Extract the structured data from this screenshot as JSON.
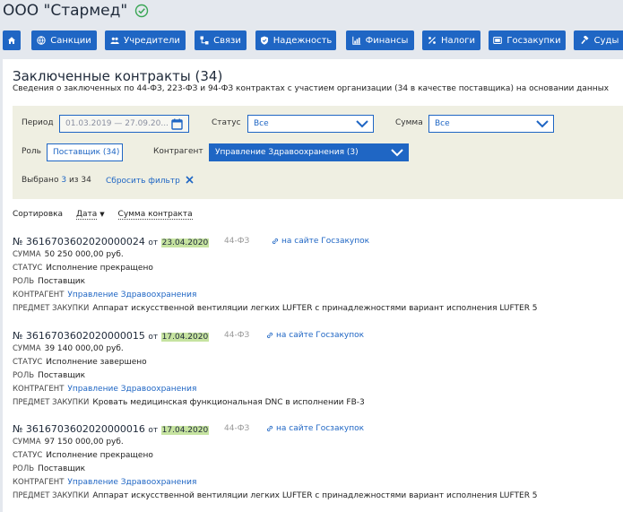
{
  "company": {
    "name": "ООО \"Стармед\"",
    "status_icon": "check-circle-icon"
  },
  "nav": {
    "items": [
      {
        "label": "",
        "icon": "home-icon"
      },
      {
        "label": "Санкции",
        "icon": "globe-icon"
      },
      {
        "label": "Учредители",
        "icon": "users-icon"
      },
      {
        "label": "Связи",
        "icon": "network-icon"
      },
      {
        "label": "Надежность",
        "icon": "shield-icon"
      },
      {
        "label": "Финансы",
        "icon": "chart-icon"
      },
      {
        "label": "Налоги",
        "icon": "percent-icon"
      },
      {
        "label": "Госзакупки",
        "icon": "card-icon"
      },
      {
        "label": "Суды",
        "icon": "gavel-icon"
      }
    ],
    "color": "#1f66c4"
  },
  "section": {
    "title": "Заключенные контракты (34)",
    "subtitle": "Сведения о заключенных по 44-ФЗ, 223-ФЗ и 94-ФЗ контрактах с участием организации (34 в качестве поставщика) на основании данных"
  },
  "filters": {
    "period_label": "Период",
    "period_value": "01.03.2019 — 27.09.20...",
    "status_label": "Статус",
    "status_value": "Все",
    "sum_label": "Сумма",
    "sum_value": "Все",
    "role_label": "Роль",
    "role_value": "Поставщик (34)",
    "counterparty_label": "Контрагент",
    "counterparty_value": "Управление Здравоохранения (3)",
    "selected_prefix": "Выбрано",
    "selected_count": "3",
    "selected_suffix": "из 34",
    "reset_label": "Сбросить фильтр"
  },
  "sort": {
    "label": "Сортировка",
    "date": "Дата",
    "sum": "Сумма контракта"
  },
  "contracts": [
    {
      "number": "№ 3616703602020000024",
      "from": "от",
      "date": "23.04.2020",
      "law": "44-ФЗ",
      "link": "на сайте Госзакупок",
      "sum_key": "СУММА",
      "sum": "50 250 000,00 руб.",
      "status_key": "СТАТУС",
      "status": "Исполнение прекращено",
      "role_key": "РОЛЬ",
      "role": "Поставщик",
      "party_key": "КОНТРАГЕНТ",
      "party": "Управление Здравоохранения",
      "subject_key": "ПРЕДМЕТ ЗАКУПКИ",
      "subject": "Аппарат искусственной вентиляции легких LUFTER с принадлежностями вариант исполнения LUFTER 5"
    },
    {
      "number": "№ 3616703602020000015",
      "from": "от",
      "date": "17.04.2020",
      "law": "44-ФЗ",
      "link": "на сайте Госзакупок",
      "sum_key": "СУММА",
      "sum": "39 140 000,00 руб.",
      "status_key": "СТАТУС",
      "status": "Исполнение завершено",
      "role_key": "РОЛЬ",
      "role": "Поставщик",
      "party_key": "КОНТРАГЕНТ",
      "party": "Управление Здравоохранения",
      "subject_key": "ПРЕДМЕТ ЗАКУПКИ",
      "subject": "Кровать медицинская функциональная DNC в исполнении FB-3"
    },
    {
      "number": "№ 3616703602020000016",
      "from": "от",
      "date": "17.04.2020",
      "law": "44-ФЗ",
      "link": "на сайте Госзакупок",
      "sum_key": "СУММА",
      "sum": "97 150 000,00 руб.",
      "status_key": "СТАТУС",
      "status": "Исполнение прекращено",
      "role_key": "РОЛЬ",
      "role": "Поставщик",
      "party_key": "КОНТРАГЕНТ",
      "party": "Управление Здравоохранения",
      "subject_key": "ПРЕДМЕТ ЗАКУПКИ",
      "subject": "Аппарат искусственной вентиляции легких LUFTER с принадлежностями вариант исполнения LUFTER 5"
    }
  ]
}
